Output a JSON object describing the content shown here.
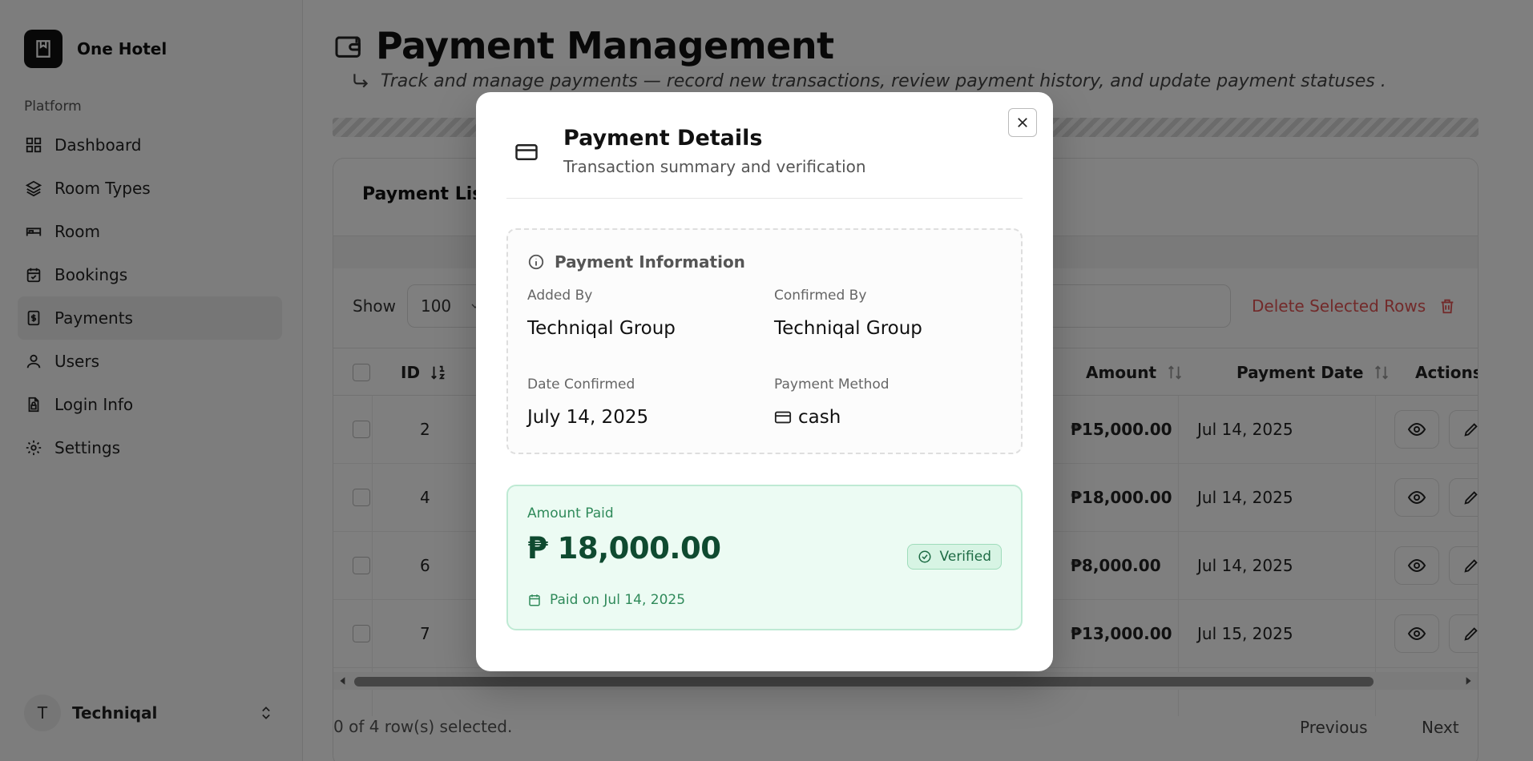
{
  "sidebar": {
    "brand": "One Hotel",
    "group_label": "Platform",
    "items": [
      {
        "label": "Dashboard",
        "icon": "dashboard-icon"
      },
      {
        "label": "Room Types",
        "icon": "layers-icon"
      },
      {
        "label": "Room",
        "icon": "bed-icon"
      },
      {
        "label": "Bookings",
        "icon": "calendar-icon"
      },
      {
        "label": "Payments",
        "icon": "receipt-icon",
        "active": true
      },
      {
        "label": "Users",
        "icon": "user-icon"
      },
      {
        "label": "Login Info",
        "icon": "file-lock-icon"
      },
      {
        "label": "Settings",
        "icon": "gear-icon"
      }
    ],
    "user": {
      "initial": "T",
      "name": "Techniqal"
    }
  },
  "page": {
    "title": "Payment Management",
    "subtitle": "Track and manage payments — record new transactions, review payment history, and update payment statuses ."
  },
  "card": {
    "title": "Payment List",
    "show_label": "Show",
    "show_value": "100",
    "delete_label": "Delete Selected Rows",
    "footer_text": "0 of 4 row(s) selected.",
    "prev_label": "Previous",
    "next_label": "Next"
  },
  "table": {
    "headers": {
      "id": "ID",
      "amount": "Amount",
      "payment_date": "Payment Date",
      "actions": "Actions"
    },
    "rows": [
      {
        "id": "2",
        "amount": "₱15,000.00",
        "date": "Jul 14, 2025"
      },
      {
        "id": "4",
        "amount": "₱18,000.00",
        "date": "Jul 14, 2025"
      },
      {
        "id": "6",
        "amount": "₱8,000.00",
        "date": "Jul 14, 2025"
      },
      {
        "id": "7",
        "amount": "₱13,000.00",
        "date": "Jul 15, 2025"
      }
    ]
  },
  "modal": {
    "title": "Payment Details",
    "subtitle": "Transaction summary and verification",
    "info_heading": "Payment Information",
    "added_by_label": "Added By",
    "added_by": "Techniqal Group",
    "confirmed_by_label": "Confirmed By",
    "confirmed_by": "Techniqal Group",
    "date_confirmed_label": "Date Confirmed",
    "date_confirmed": "July 14, 2025",
    "method_label": "Payment Method",
    "method": "cash",
    "amount_label": "Amount Paid",
    "amount": "₱ 18,000.00",
    "status": "Verified",
    "paid_on": "Paid on Jul 14, 2025"
  },
  "colors": {
    "overlay": "#000000",
    "paid_bg": "#ecfbf3",
    "paid_text": "#0f4a30",
    "danger": "#e45454"
  }
}
